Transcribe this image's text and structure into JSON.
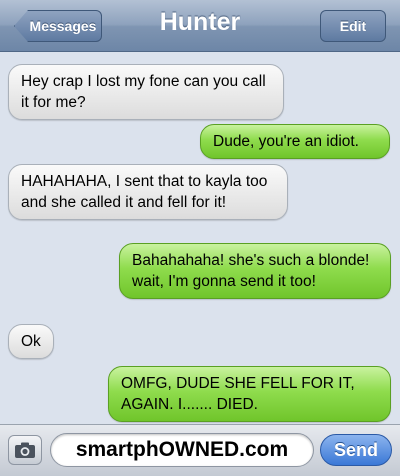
{
  "header": {
    "back_label": "Messages",
    "title": "Hunter",
    "edit_label": "Edit"
  },
  "messages": [
    {
      "direction": "incoming",
      "text": "Hey crap I lost my fone can you call it for me?"
    },
    {
      "direction": "outgoing",
      "text": "Dude, you're an idiot."
    },
    {
      "direction": "incoming",
      "text": "HAHAHAHA, I sent that to kayla too and she called it and fell for it!"
    },
    {
      "direction": "outgoing",
      "text": "Bahahahaha! she's such a blonde! wait, I'm gonna send it too!"
    },
    {
      "direction": "incoming",
      "text": "Ok"
    },
    {
      "direction": "outgoing",
      "text": "OMFG, DUDE SHE FELL FOR IT, AGAIN. I....... DIED."
    }
  ],
  "composer": {
    "camera_icon": "camera-icon",
    "input_text": "smartphOWNED.com",
    "send_label": "Send"
  },
  "colors": {
    "incoming_bubble": "#e8e8e8",
    "outgoing_bubble": "#8fdc4d",
    "background": "#dbe2ed",
    "navbar": "#8ea2bd",
    "send_button": "#3a78d6"
  }
}
